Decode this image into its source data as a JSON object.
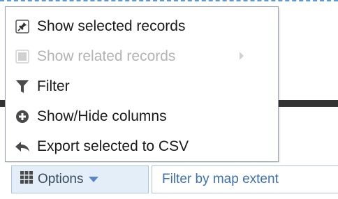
{
  "menu": {
    "items": [
      {
        "label": "Show selected records",
        "icon": "pin-icon",
        "enabled": true
      },
      {
        "label": "Show related records",
        "icon": "related-records-icon",
        "enabled": false,
        "has_submenu": true
      },
      {
        "label": "Filter",
        "icon": "filter-funnel-icon",
        "enabled": true
      },
      {
        "label": "Show/Hide columns",
        "icon": "plus-circle-icon",
        "enabled": true
      },
      {
        "label": "Export selected to CSV",
        "icon": "export-arrow-icon",
        "enabled": true
      }
    ]
  },
  "toolbar": {
    "options_label": "Options",
    "filter_label": "Filter by map extent"
  },
  "colors": {
    "accent": "#3b6fb6",
    "disabled_text": "#b3b3b3",
    "options_bg": "#e3eef9"
  }
}
